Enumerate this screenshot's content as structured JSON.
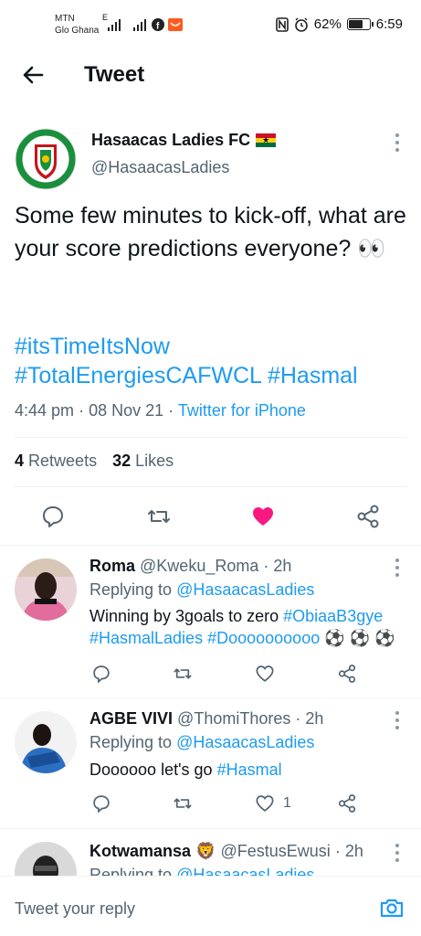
{
  "status_bar": {
    "carrier1": "MTN",
    "carrier2": "Glo Ghana",
    "network": "E",
    "battery": "62%",
    "time": "6:59"
  },
  "header": {
    "title": "Tweet"
  },
  "tweet": {
    "author_name": "Hasaacas Ladies FC",
    "author_handle": "@HasaacasLadies",
    "text": "Some few minutes to kick-off, what are your score predictions everyone? 👀",
    "hashtags_line1": "#itsTimeItsNow",
    "hashtags_line2": "#TotalEnergiesCAFWCL #Hasmal",
    "time": "4:44 pm",
    "date": "08 Nov 21",
    "source": "Twitter for iPhone",
    "retweets_count": "4",
    "retweets_label": "Retweets",
    "likes_count": "32",
    "likes_label": "Likes",
    "liked": true
  },
  "replies": [
    {
      "name": "Roma",
      "handle": "@Kweku_Roma",
      "age": "2h",
      "replying_prefix": "Replying to",
      "replying_to": "@HasaacasLadies",
      "text_plain": "Winning by 3goals to zero",
      "text_tag1": "#ObiaaB3gye",
      "text_tag2": "#HasmalLadies",
      "text_tag3": "#Doooooooooo",
      "text_emoji": "⚽ ⚽ ⚽",
      "like_count": ""
    },
    {
      "name": "AGBE VIVI",
      "handle": "@ThomiThores",
      "age": "2h",
      "replying_prefix": "Replying to",
      "replying_to": "@HasaacasLadies",
      "text_plain": "Doooooo let's go",
      "text_tag1": "#Hasmal",
      "like_count": "1"
    },
    {
      "name": "Kotwamansa",
      "name_emoji": "🦁",
      "handle": "@FestusEwusi",
      "age": "2h",
      "replying_prefix": "Replying to",
      "replying_to": "@HasaacasLadies"
    }
  ],
  "composer": {
    "placeholder": "Tweet your reply"
  },
  "colors": {
    "accent": "#1d9bf0",
    "like": "#f91880",
    "text": "#0f1419",
    "secondary": "#536471"
  }
}
